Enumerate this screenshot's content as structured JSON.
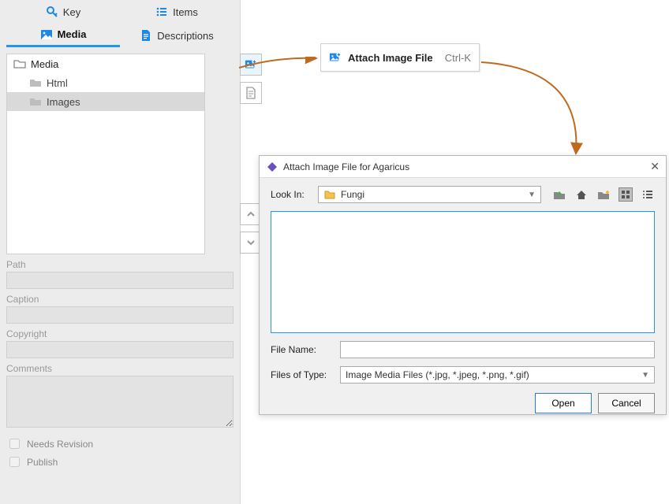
{
  "tabs": {
    "key": "Key",
    "items": "Items",
    "media": "Media",
    "descriptions": "Descriptions"
  },
  "tree": {
    "root": "Media",
    "html": "Html",
    "images": "Images"
  },
  "fields": {
    "path_label": "Path",
    "caption_label": "Caption",
    "copyright_label": "Copyright",
    "comments_label": "Comments",
    "path": "",
    "caption": "",
    "copyright": "",
    "comments": ""
  },
  "checks": {
    "needs_revision": "Needs Revision",
    "publish": "Publish"
  },
  "attach_tip": {
    "label": "Attach Image File",
    "shortcut": "Ctrl-K"
  },
  "dialog": {
    "title": "Attach Image File for Agaricus",
    "lookin_label": "Look In:",
    "lookin_value": "Fungi",
    "file_name_label": "File Name:",
    "file_name_value": "",
    "files_of_type_label": "Files of Type:",
    "files_of_type_value": "Image Media Files (*.jpg, *.jpeg, *.png, *.gif)",
    "open": "Open",
    "cancel": "Cancel"
  }
}
